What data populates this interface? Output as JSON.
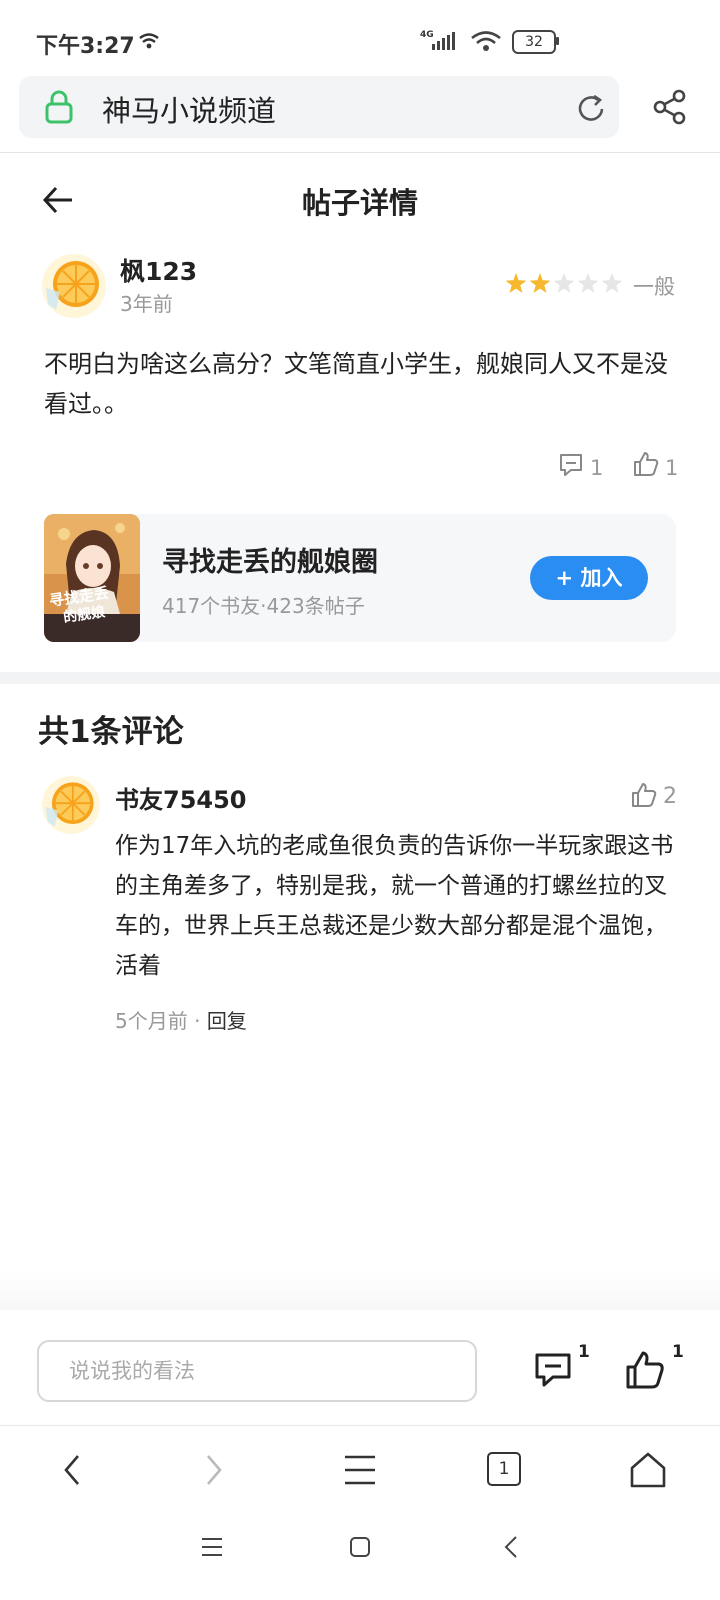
{
  "status_bar": {
    "time": "下午3:27",
    "network": "4G",
    "battery": "32"
  },
  "browser": {
    "site_title": "神马小说频道"
  },
  "header": {
    "title": "帖子详情"
  },
  "post": {
    "author": "枫123",
    "time": "3年前",
    "rating_stars": 2,
    "rating_max": 5,
    "rating_label": "一般",
    "content": "不明白为啥这么高分？文笔简直小学生，舰娘同人又不是没看过。。",
    "comment_count": "1",
    "like_count": "1"
  },
  "group": {
    "name": "寻找走丢的舰娘圈",
    "stats": "417个书友·423条帖子",
    "join_label": "加入"
  },
  "comments": {
    "title": "共1条评论",
    "items": [
      {
        "author": "书友75450",
        "likes": "2",
        "text": "作为17年入坑的老咸鱼很负责的告诉你一半玩家跟这书的主角差多了，特别是我，就一个普通的打螺丝拉的叉车的，世界上兵王总裁还是少数大部分都是混个温饱，活着",
        "time": "5个月前",
        "separator": "·",
        "reply_label": "回复"
      }
    ]
  },
  "input_bar": {
    "placeholder": "说说我的看法",
    "comment_badge": "1",
    "like_badge": "1"
  },
  "browser_nav": {
    "tab_count": "1"
  },
  "colors": {
    "accent": "#2a8df1",
    "star": "#f5b82e",
    "lock": "#3cc36a"
  }
}
